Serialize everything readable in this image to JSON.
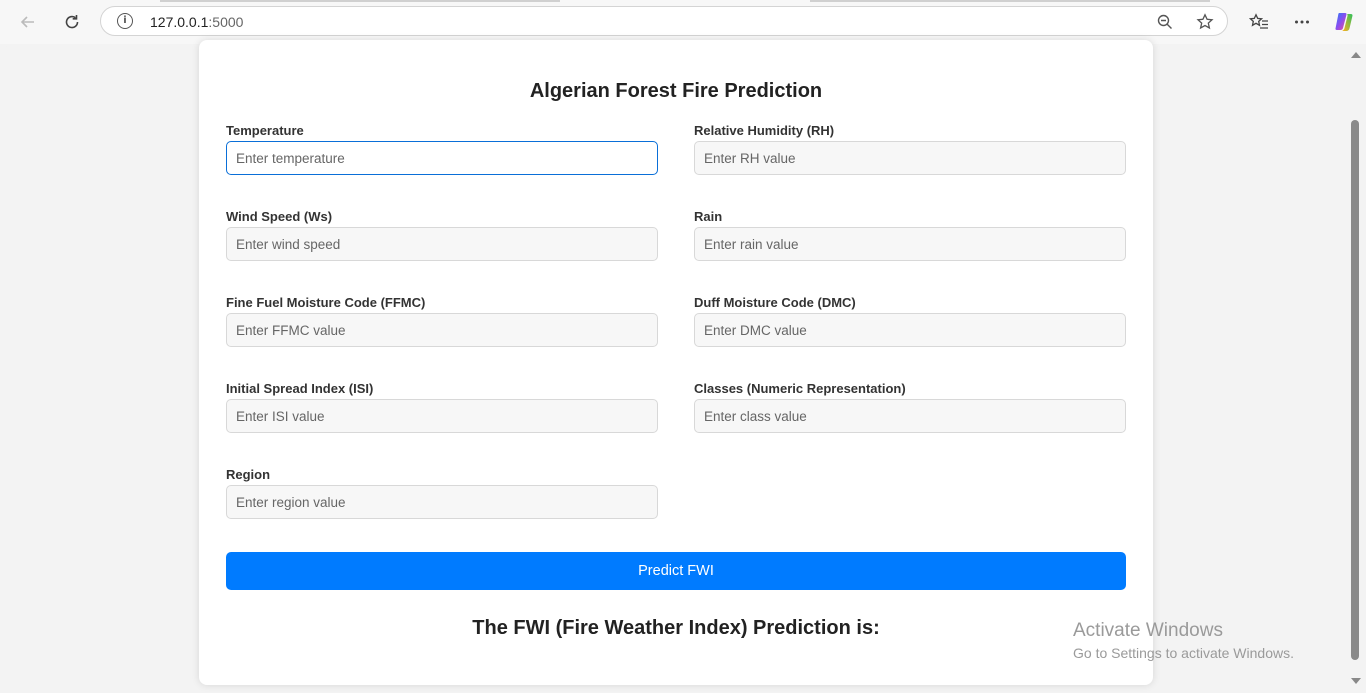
{
  "browser": {
    "url_host": "127.0.0.1",
    "url_port": ":5000",
    "back_icon": "arrow-left",
    "reload_icon": "reload",
    "info_icon": "info",
    "info_glyph": "i",
    "zoom_icon": "zoom-out",
    "favorite_icon": "star",
    "favorites_list_icon": "favorites",
    "more_icon": "ellipsis",
    "copilot_icon": "copilot"
  },
  "page": {
    "title": "Algerian Forest Fire Prediction",
    "fields": [
      {
        "label": "Temperature",
        "placeholder": "Enter temperature"
      },
      {
        "label": "Relative Humidity (RH)",
        "placeholder": "Enter RH value"
      },
      {
        "label": "Wind Speed (Ws)",
        "placeholder": "Enter wind speed"
      },
      {
        "label": "Rain",
        "placeholder": "Enter rain value"
      },
      {
        "label": "Fine Fuel Moisture Code (FFMC)",
        "placeholder": "Enter FFMC value"
      },
      {
        "label": "Duff Moisture Code (DMC)",
        "placeholder": "Enter DMC value"
      },
      {
        "label": "Initial Spread Index (ISI)",
        "placeholder": "Enter ISI value"
      },
      {
        "label": "Classes (Numeric Representation)",
        "placeholder": "Enter class value"
      },
      {
        "label": "Region",
        "placeholder": "Enter region value"
      }
    ],
    "submit_label": "Predict FWI",
    "result_text": "The FWI (Fire Weather Index) Prediction is:"
  },
  "watermark": {
    "line1": "Activate Windows",
    "line2": "Go to Settings to activate Windows."
  },
  "colors": {
    "primary": "#007bff",
    "focus_border": "#0a6fd8"
  }
}
